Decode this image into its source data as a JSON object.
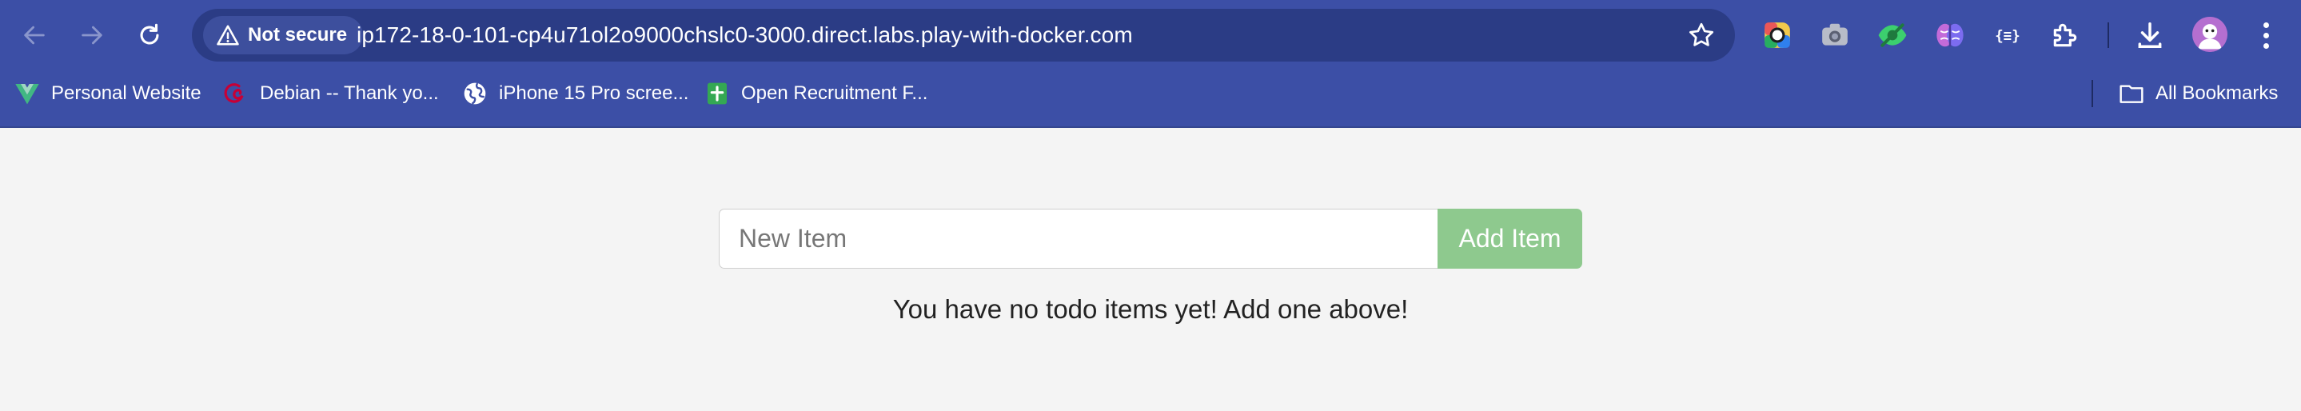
{
  "browser": {
    "security_label": "Not secure",
    "url": "ip172-18-0-101-cp4u71ol2o9000chslc0-3000.direct.labs.play-with-docker.com",
    "bookmarks": [
      {
        "label": "Personal Website",
        "icon": "vue-logo-icon"
      },
      {
        "label": "Debian -- Thank yo...",
        "icon": "debian-swirl-icon"
      },
      {
        "label": "iPhone 15 Pro scree...",
        "icon": "globe-icon"
      },
      {
        "label": "Open Recruitment F...",
        "icon": "google-forms-icon"
      }
    ],
    "all_bookmarks_label": "All Bookmarks",
    "extensions": [
      "color-picker-icon",
      "camera-icon",
      "eye-icon",
      "brain-icon",
      "json-icon",
      "puzzle-icon"
    ],
    "colors": {
      "toolbar": "#3c4fa6",
      "omnibox": "#2b3c85"
    }
  },
  "todo": {
    "input_placeholder": "New Item",
    "add_button_label": "Add Item",
    "empty_message": "You have no todo items yet! Add one above!",
    "colors": {
      "button": "#8ec98e",
      "background": "#f4f4f4"
    }
  }
}
